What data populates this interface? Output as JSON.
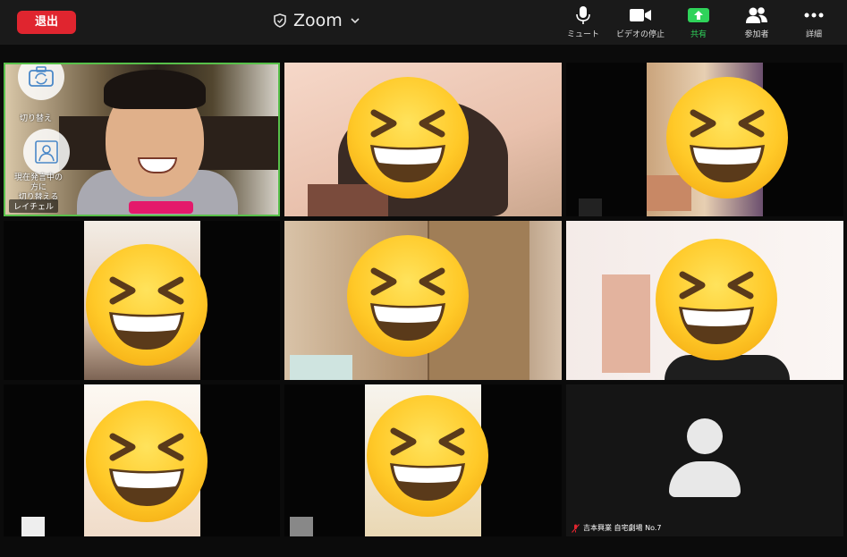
{
  "topbar": {
    "leave_label": "退出",
    "title": "Zoom",
    "items": [
      {
        "id": "mute",
        "label": "ミュート",
        "icon": "microphone-icon"
      },
      {
        "id": "video",
        "label": "ビデオの停止",
        "icon": "video-camera-icon"
      },
      {
        "id": "share",
        "label": "共有",
        "icon": "share-screen-icon"
      },
      {
        "id": "participants",
        "label": "参加者",
        "icon": "participants-icon"
      },
      {
        "id": "more",
        "label": "詳細",
        "icon": "more-dots-icon"
      }
    ]
  },
  "self_tile": {
    "name": "レイチェル",
    "switch_camera_label": "切り替え",
    "switch_speaker_label_1": "現在発言中の",
    "switch_speaker_label_2": "方に",
    "switch_speaker_label_3": "切り替える"
  },
  "last_tile": {
    "caption": "吉本興業 自宅劇場 No.7"
  },
  "colors": {
    "leave": "#e0252f",
    "share": "#2fd35a",
    "active_border": "#58c04a"
  }
}
